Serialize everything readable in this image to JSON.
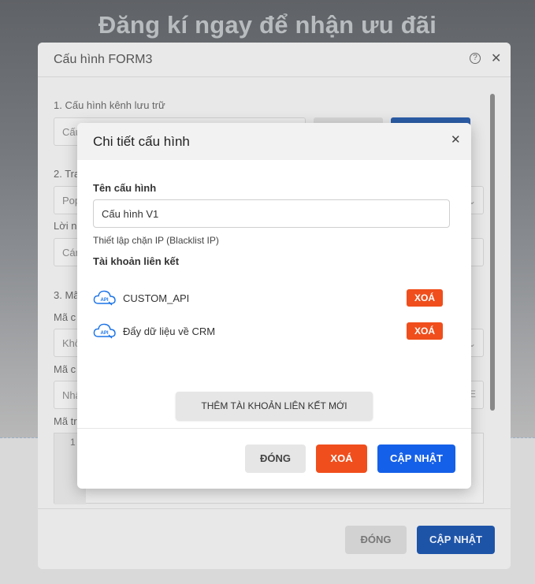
{
  "background": {
    "headline": "Đăng kí ngay để nhận ưu đãi"
  },
  "outer_modal": {
    "title": "Cấu hình FORM3",
    "section1": "1. Cấu hình kênh lưu trữ",
    "field1_value": "Cấu",
    "section2": "2. Tra",
    "field2_value": "Pop",
    "label_loi": "Lời n",
    "field3_value": "Cán",
    "section3": "3. Mã",
    "label_ma1": "Mã c",
    "field4_value": "Khô",
    "label_ma2": "Mã c",
    "field5_value": "Nhậ",
    "field5_suffix": "E",
    "label_ma3": "Mã tr",
    "editor_line": "1",
    "footer": {
      "close_label": "ĐÓNG",
      "update_label": "CẬP NHẬT"
    }
  },
  "inner_modal": {
    "title": "Chi tiết cấu hình",
    "name_label": "Tên cấu hình",
    "name_value": "Cấu hình V1",
    "ip_hint": "Thiết lập chặn IP (Blacklist IP)",
    "linked_title": "Tài khoản liên kết",
    "accounts": [
      {
        "name": "CUSTOM_API",
        "icon": "api-cloud-icon",
        "delete_label": "XOÁ"
      },
      {
        "name": "Đẩy dữ liệu về CRM",
        "icon": "api-cloud-icon",
        "delete_label": "XOÁ"
      }
    ],
    "add_label": "THÊM TÀI KHOẢN LIÊN KẾT MỚI",
    "footer": {
      "close_label": "ĐÓNG",
      "delete_label": "XOÁ",
      "update_label": "CẬP NHẬT"
    }
  },
  "colors": {
    "primary_blue": "#1560e8",
    "danger_orange": "#f04e1c",
    "outer_blue": "#1e54a8"
  }
}
